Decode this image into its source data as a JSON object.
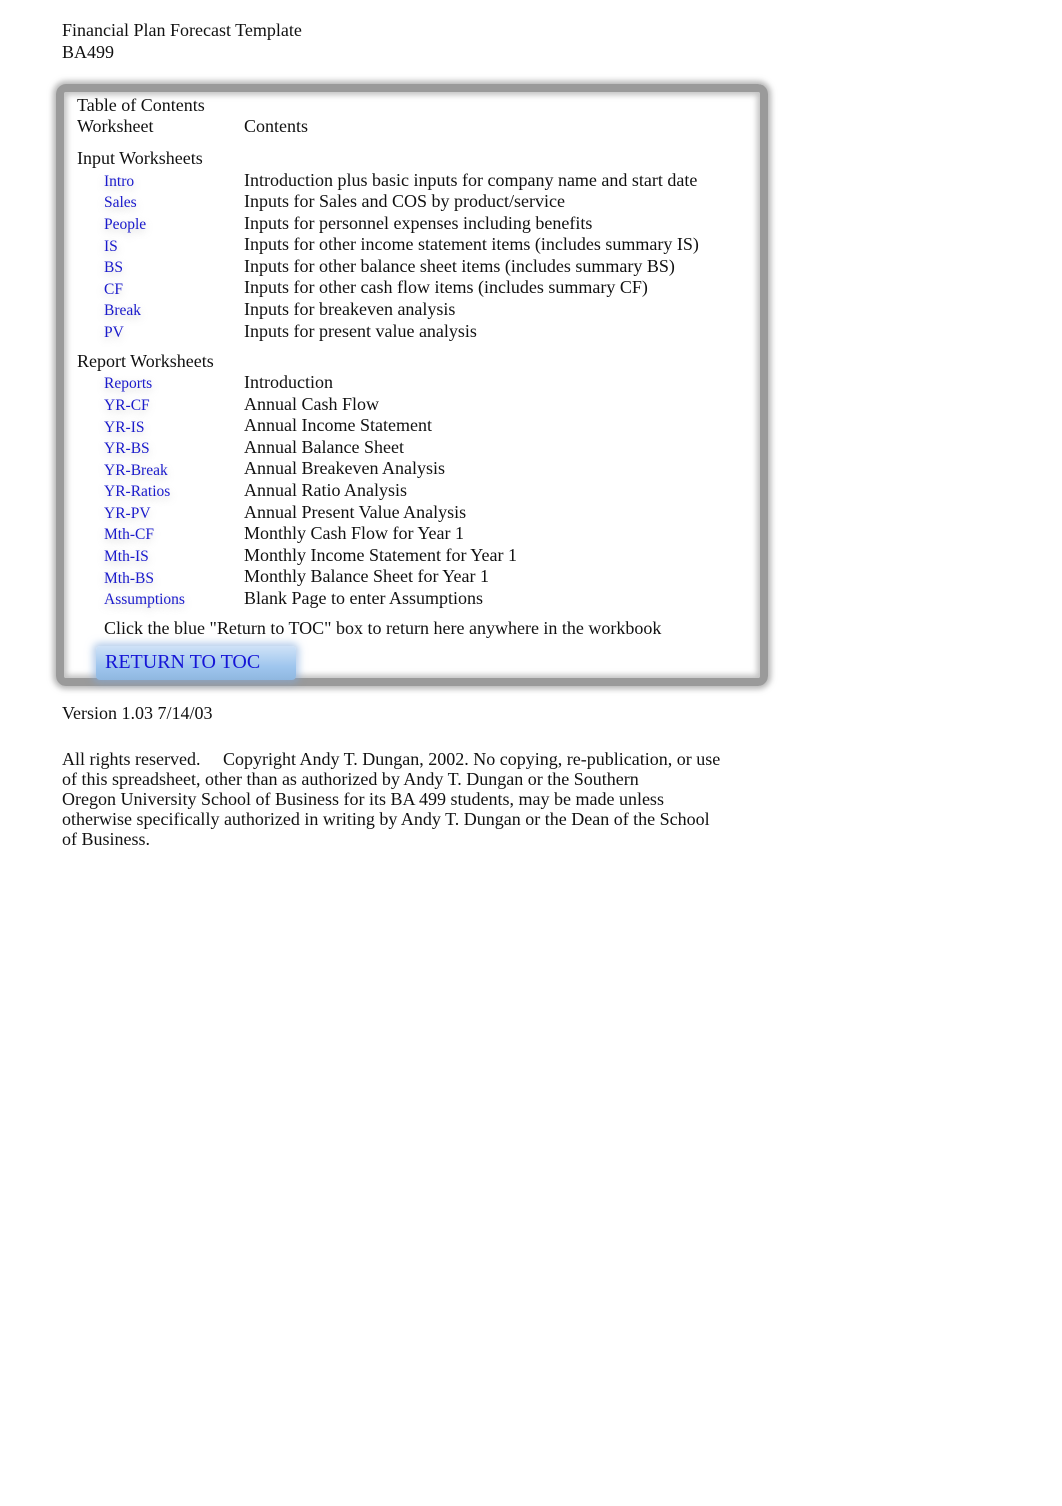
{
  "document": {
    "title": "Financial Plan Forecast Template",
    "subtitle": "BA499"
  },
  "toc": {
    "heading": "Table of Contents",
    "column_worksheet": "Worksheet",
    "column_contents": "Contents",
    "input_section": {
      "label": "Input Worksheets",
      "items": [
        {
          "name": "Intro",
          "description": "Introduction plus basic inputs for company name and start date"
        },
        {
          "name": "Sales",
          "description": "Inputs for Sales and COS by product/service"
        },
        {
          "name": "People",
          "description": "Inputs for personnel expenses including benefits"
        },
        {
          "name": "IS",
          "description": "Inputs for other income statement items (includes summary IS)"
        },
        {
          "name": "BS",
          "description": "Inputs for other balance sheet items (includes summary BS)"
        },
        {
          "name": "CF",
          "description": "Inputs for other cash flow items (includes summary CF)"
        },
        {
          "name": "Break",
          "description": "Inputs for breakeven analysis"
        },
        {
          "name": "PV",
          "description": "Inputs for present value analysis"
        }
      ]
    },
    "report_section": {
      "label": "Report Worksheets",
      "items": [
        {
          "name": "Reports",
          "description": "Introduction"
        },
        {
          "name": "YR-CF",
          "description": "Annual Cash Flow"
        },
        {
          "name": "YR-IS",
          "description": "Annual Income Statement"
        },
        {
          "name": "YR-BS",
          "description": "Annual Balance Sheet"
        },
        {
          "name": "YR-Break",
          "description": "Annual Breakeven Analysis"
        },
        {
          "name": "YR-Ratios",
          "description": "Annual Ratio Analysis"
        },
        {
          "name": "YR-PV",
          "description": "Annual Present Value Analysis"
        },
        {
          "name": "Mth-CF",
          "description": "Monthly Cash Flow for Year 1"
        },
        {
          "name": "Mth-IS",
          "description": "Monthly Income Statement for Year 1"
        },
        {
          "name": "Mth-BS",
          "description": "Monthly Balance Sheet for Year 1"
        },
        {
          "name": "Assumptions",
          "description": "Blank Page to enter Assumptions"
        }
      ]
    },
    "instruction": "Click the blue \"Return to TOC\" box to return here anywhere in the workbook",
    "return_button": "RETURN TO TOC"
  },
  "version": "Version 1.03 7/14/03",
  "copyright_lines": [
    "All rights reserved.     Copyright Andy T. Dungan, 2002. No copying, re-publication, or use",
    "of this spreadsheet, other than as authorized by Andy T. Dungan or the Southern",
    "Oregon University School of Business for its BA 499 students, may be made unless",
    "otherwise specifically authorized in writing by Andy T. Dungan or the Dean of the School",
    "of Business."
  ],
  "colors": {
    "link": "#1a1acc",
    "button_bg": "#9fc6ee",
    "frame": "#9a9a9a"
  }
}
